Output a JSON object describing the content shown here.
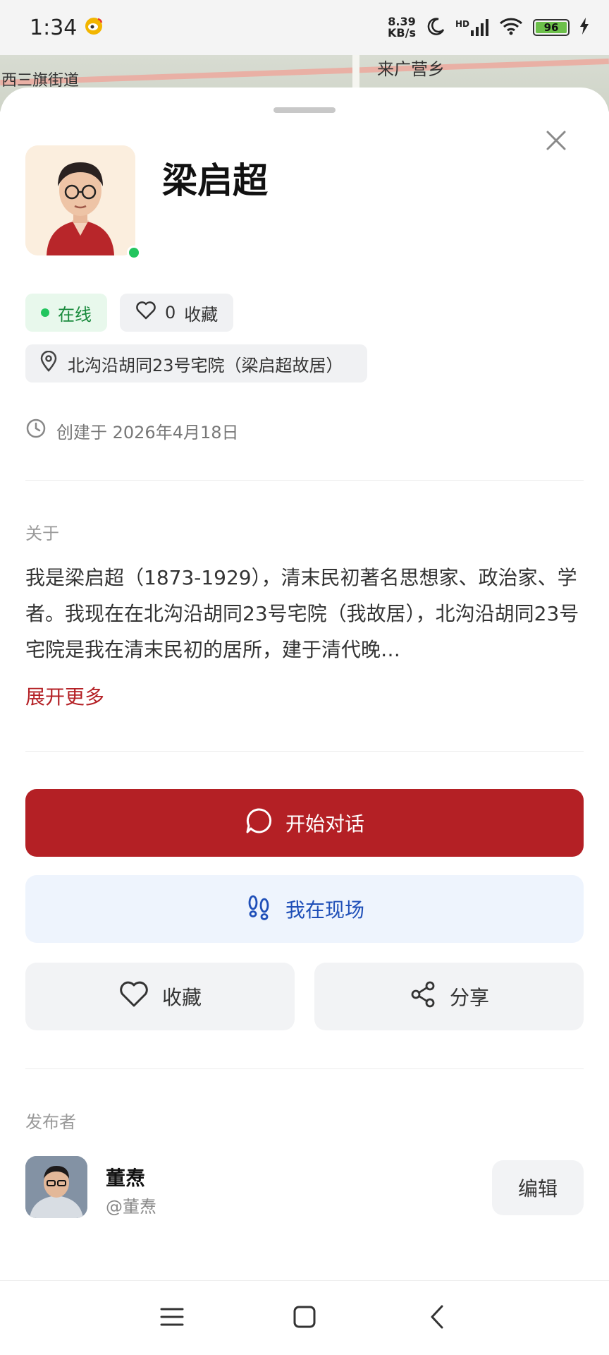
{
  "status_bar": {
    "time": "1:34",
    "net_speed_value": "8.39",
    "net_speed_unit": "KB/s",
    "signal_label": "HD",
    "battery": "96"
  },
  "map": {
    "label_1": "来广营乡",
    "label_2": "西三旗街道"
  },
  "profile": {
    "name": "梁启超",
    "status_label": "在线",
    "favorites_count": "0",
    "favorites_label": "收藏",
    "location": "北沟沿胡同23号宅院（梁启超故居）",
    "created": "创建于 2026年4月18日"
  },
  "about": {
    "label": "关于",
    "text": "我是梁启超（1873-1929），清末民初著名思想家、政治家、学者。我现在在北沟沿胡同23号宅院（我故居），北沟沿胡同23号宅院是我在清末民初的居所，建于清代晚…",
    "expand_label": "展开更多"
  },
  "actions": {
    "start_chat": "开始对话",
    "on_site": "我在现场",
    "favorite": "收藏",
    "share": "分享"
  },
  "publisher": {
    "section_label": "发布者",
    "name": "董焘",
    "handle": "@董焘",
    "edit_label": "编辑"
  },
  "colors": {
    "primary": "#b42025",
    "online_green": "#22c55e",
    "secondary_blue": "#1f4fb8"
  }
}
